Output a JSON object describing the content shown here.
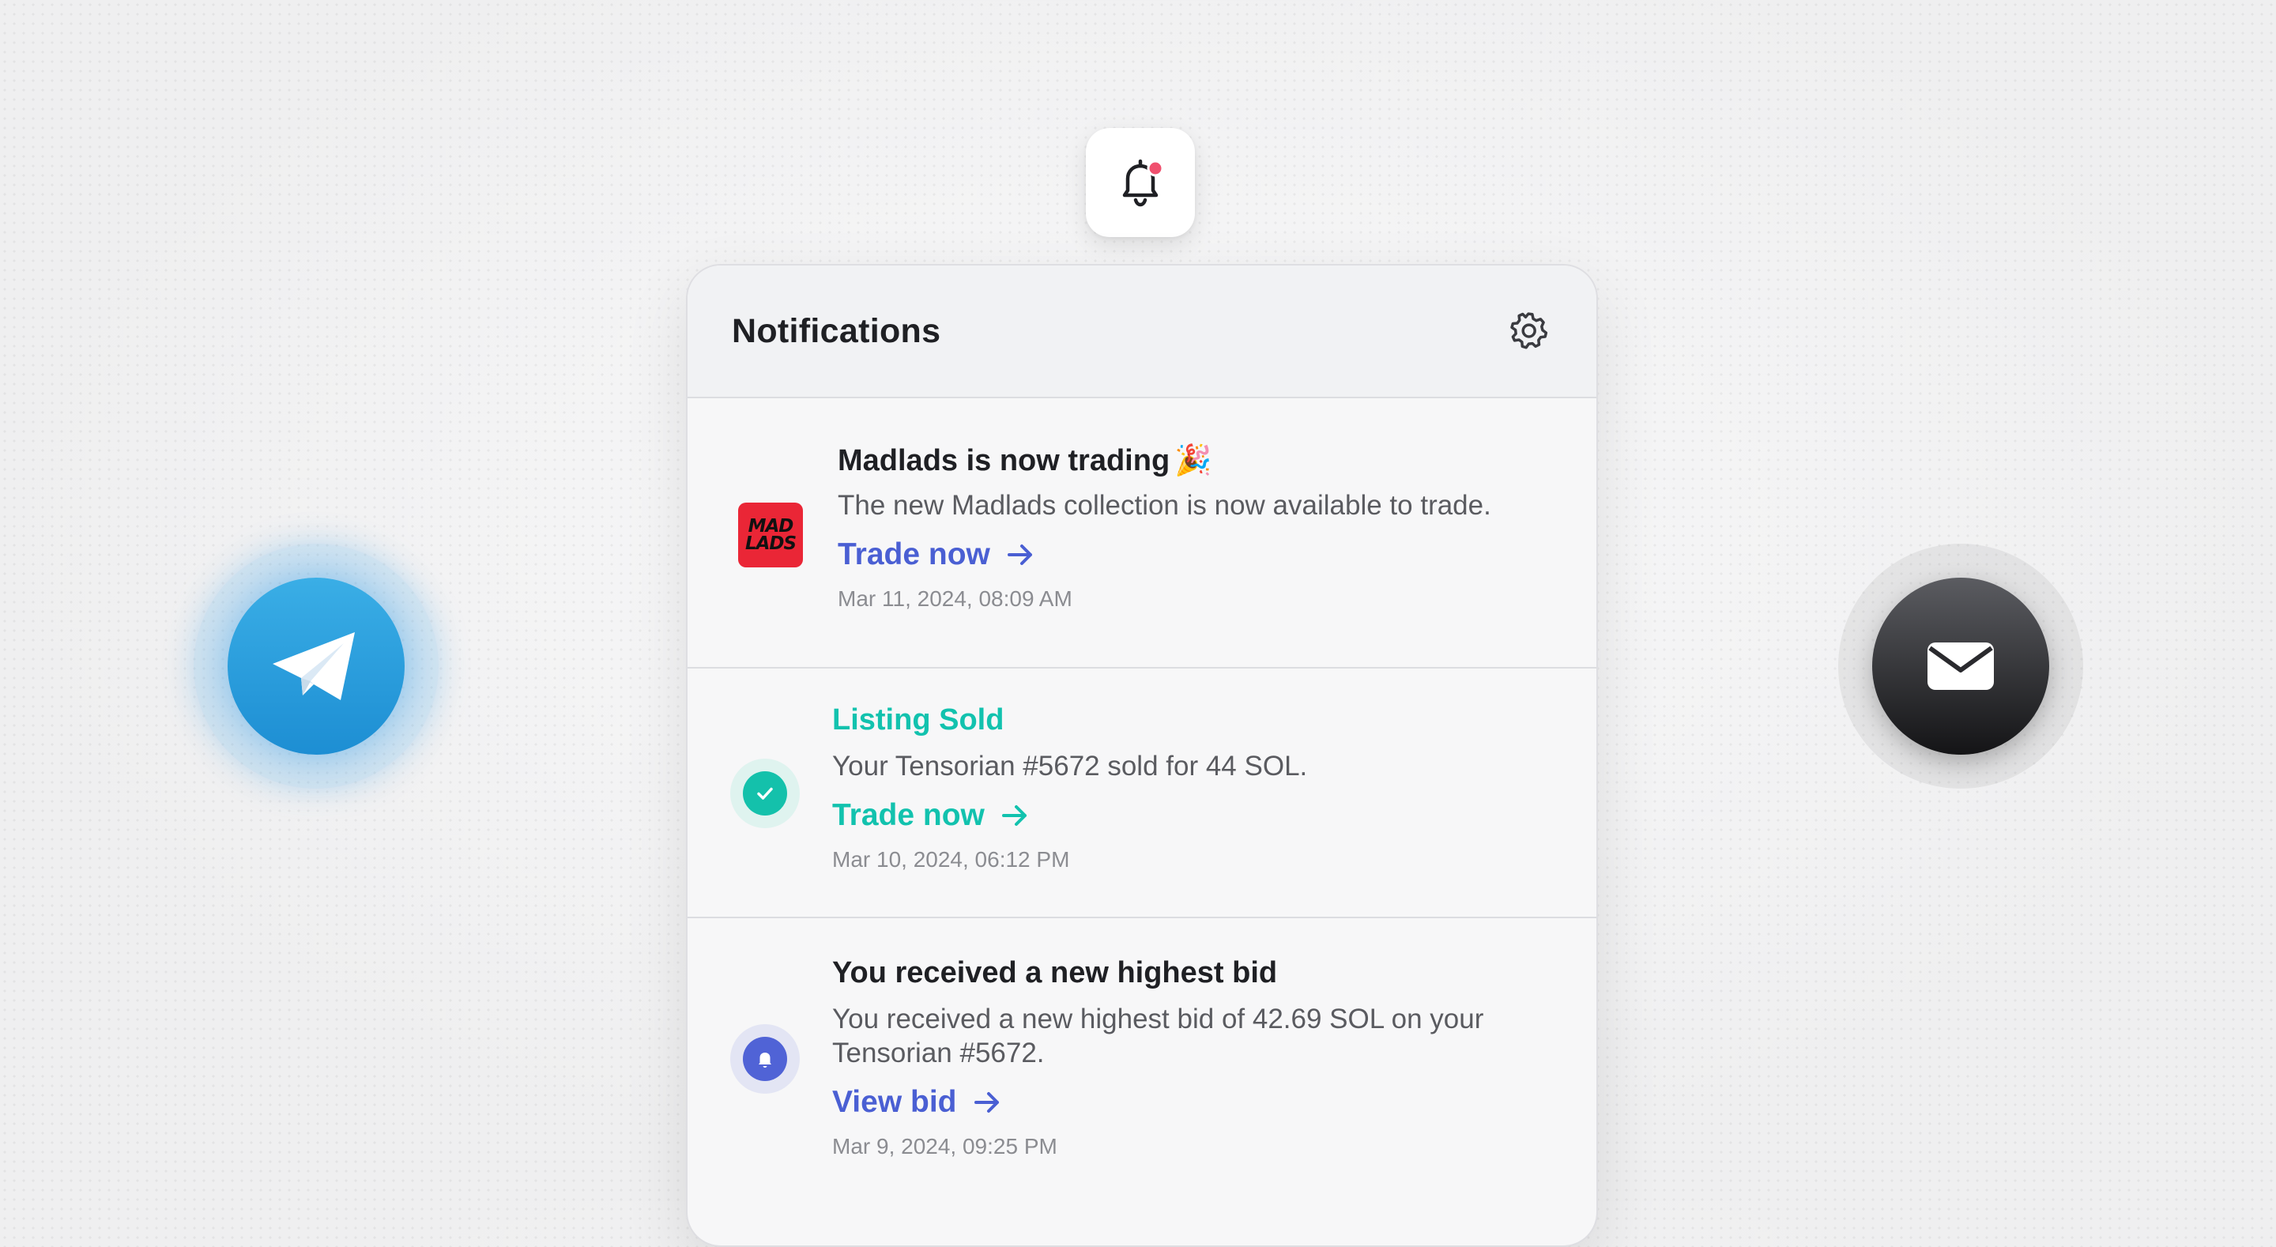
{
  "header": {
    "title": "Notifications",
    "bell_icon": "bell-icon",
    "settings_icon": "gear-icon"
  },
  "channels": {
    "left": "telegram-icon",
    "right": "mail-icon"
  },
  "notifications": [
    {
      "title": "Madlads is now trading",
      "title_emoji": "🎉",
      "logo_text": [
        "MAD",
        "LADS"
      ],
      "body": "The new Madlads collection is now available to trade.",
      "action": "Trade now",
      "time": "Mar 11, 2024, 08:09 AM"
    },
    {
      "title": "Listing Sold",
      "body": "Your Tensorian #5672 sold for 44 SOL.",
      "action": "Trade now",
      "time": "Mar 10, 2024, 06:12 PM"
    },
    {
      "title": "You received a new highest bid",
      "body": "You received a new highest bid of 42.69 SOL on your Tensorian #5672.",
      "action": "View bid",
      "time": "Mar 9, 2024, 09:25 PM"
    }
  ],
  "colors": {
    "accent_blue": "#4a5fd3",
    "accent_teal": "#12c2ae",
    "unread_dot": "#f0506e",
    "telegram": "#2a9fe0"
  }
}
